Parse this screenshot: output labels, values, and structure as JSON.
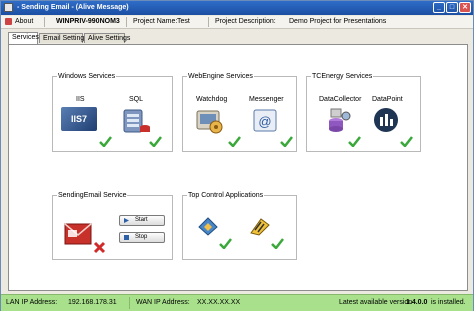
{
  "window": {
    "title": "- Sending Email - (Alive Message)",
    "min_glyph": "_",
    "max_glyph": "□",
    "close_glyph": "✕"
  },
  "toolbar": {
    "about_label": "About",
    "machine_name": "WINPRIV-990NOM3",
    "project_name_label": "Project Name:",
    "project_name_value": "Test",
    "project_desc_label": "Project Description:",
    "project_desc_value": "Demo Project for Presentations"
  },
  "tabs": [
    {
      "label": "Services",
      "active": true
    },
    {
      "label": "Email Settings",
      "active": false
    },
    {
      "label": "Alive Settings",
      "active": false
    }
  ],
  "groups": {
    "windows_services": {
      "title": "Windows Services",
      "items": [
        {
          "label": "IIS",
          "icon": "iis7-icon",
          "icon_text": "IIS7",
          "status": "ok"
        },
        {
          "label": "SQL",
          "icon": "sql-server-icon",
          "status": "ok"
        }
      ]
    },
    "webengine_services": {
      "title": "WebEngine Services",
      "items": [
        {
          "label": "Watchdog",
          "icon": "watchdog-icon",
          "status": "ok"
        },
        {
          "label": "Messenger",
          "icon": "messenger-icon",
          "status": "ok"
        }
      ]
    },
    "tcenergy_services": {
      "title": "TCEnergy Services",
      "items": [
        {
          "label": "DataCollector",
          "icon": "datacollector-icon",
          "status": "ok"
        },
        {
          "label": "DataPoint",
          "icon": "datapoint-icon",
          "status": "ok"
        }
      ]
    },
    "sending_email_service": {
      "title": "SendingEmail Service",
      "status": "stopped",
      "start_label": "Start",
      "stop_label": "Stop"
    },
    "top_control_apps": {
      "title": "Top Control Applications",
      "items": [
        {
          "icon": "top-control-app-1-icon",
          "status": "ok"
        },
        {
          "icon": "top-control-app-2-icon",
          "status": "ok"
        }
      ]
    }
  },
  "status_bar": {
    "lan_label": "LAN IP Address:",
    "lan_value": "192.168.178.31",
    "wan_label": "WAN IP Address:",
    "wan_value": "XX.XX.XX.XX",
    "version_prefix": "Latest available version",
    "version_value": "1.4.0.0",
    "version_suffix": "is installed."
  },
  "colors": {
    "status_bar_bg": "#a8e08c",
    "check_green": "#3aa83a",
    "error_red": "#d12a2a",
    "title_blue": "#1b4fa3"
  }
}
